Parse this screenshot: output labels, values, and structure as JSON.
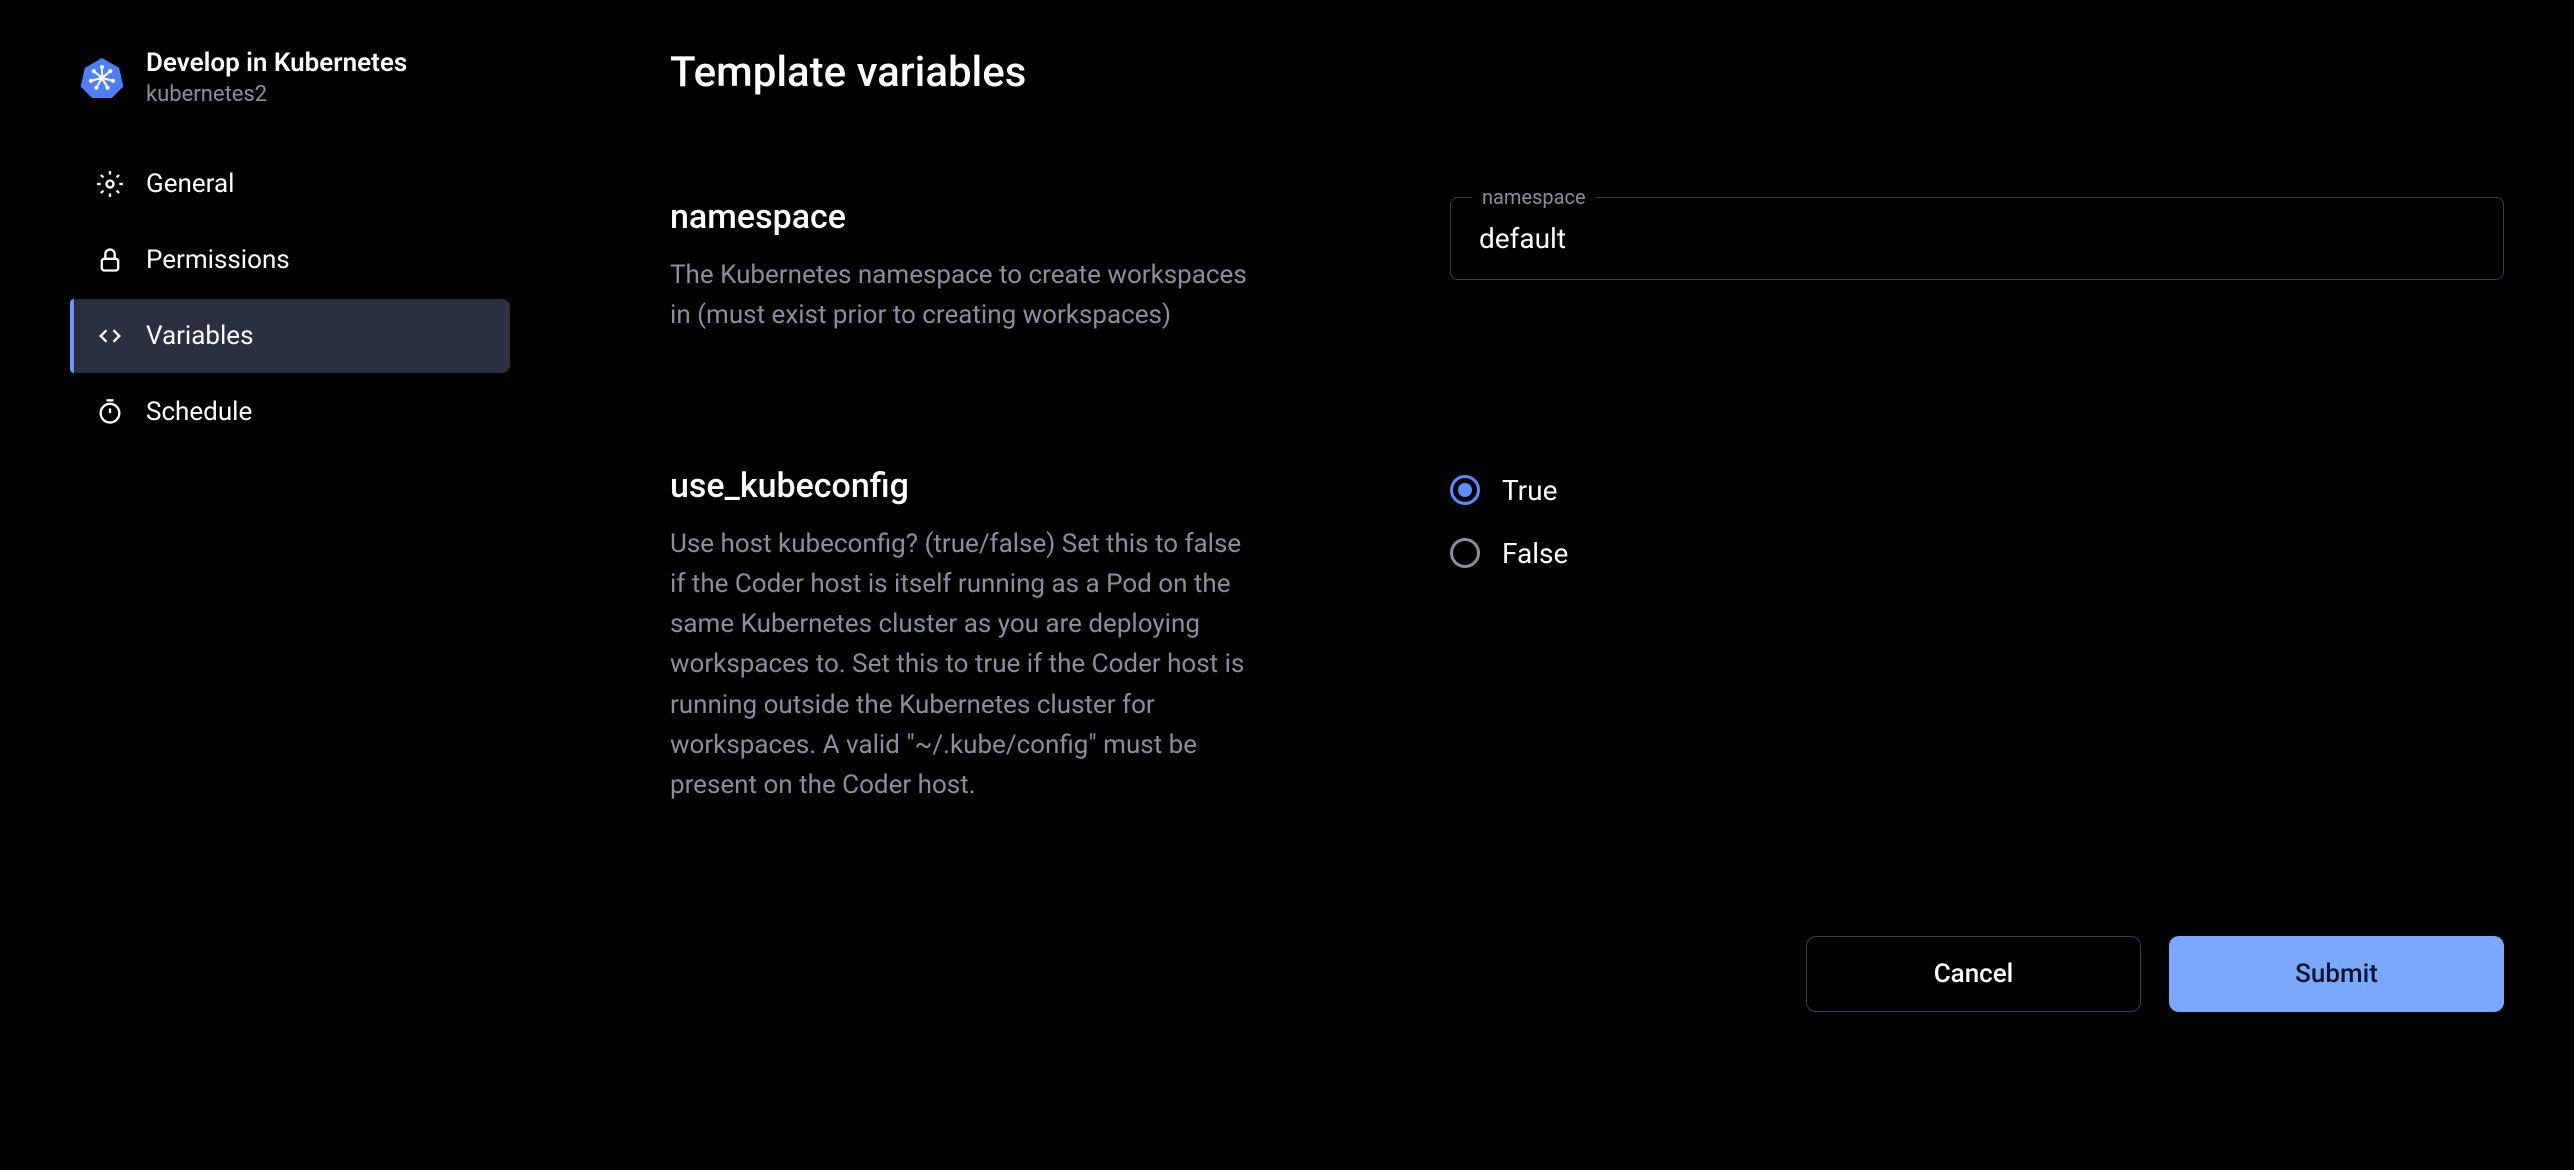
{
  "sidebar": {
    "title": "Develop in Kubernetes",
    "subtitle": "kubernetes2",
    "nav": [
      {
        "label": "General"
      },
      {
        "label": "Permissions"
      },
      {
        "label": "Variables"
      },
      {
        "label": "Schedule"
      }
    ]
  },
  "page": {
    "title": "Template variables"
  },
  "variables": {
    "namespace": {
      "name": "namespace",
      "description": "The Kubernetes namespace to create workspaces in (must exist prior to creating workspaces)",
      "input_label": "namespace",
      "value": "default"
    },
    "use_kubeconfig": {
      "name": "use_kubeconfig",
      "description": "Use host kubeconfig? (true/false) Set this to false if the Coder host is itself running as a Pod on the same Kubernetes cluster as you are deploying workspaces to. Set this to true if the Coder host is running outside the Kubernetes cluster for workspaces. A valid \"~/.kube/config\" must be present on the Coder host.",
      "options": {
        "true_label": "True",
        "false_label": "False"
      },
      "selected": "true"
    }
  },
  "actions": {
    "cancel": "Cancel",
    "submit": "Submit"
  }
}
